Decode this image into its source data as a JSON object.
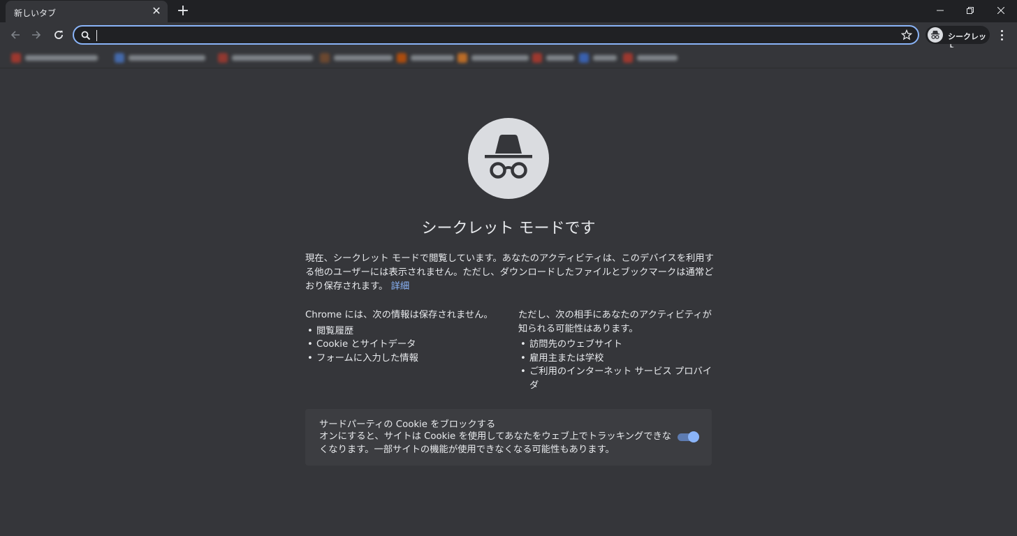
{
  "tab": {
    "title": "新しいタブ"
  },
  "toolbar": {
    "omnibox_value": "",
    "profile_label": "シークレット"
  },
  "main": {
    "heading": "シークレット モードです",
    "intro": "現在、シークレット モードで閲覧しています。あなたのアクティビティは、このデバイスを利用する他のユーザーには表示されません。ただし、ダウンロードしたファイルとブックマークは通常どおり保存されます。",
    "learn_more": "詳細",
    "not_saved": {
      "title": "Chrome には、次の情報は保存されません。",
      "items": [
        "閲覧履歴",
        "Cookie とサイトデータ",
        "フォームに入力した情報"
      ]
    },
    "may_be_visible": {
      "title": "ただし、次の相手にあなたのアクティビティが知られる可能性はあります。",
      "items": [
        "訪問先のウェブサイト",
        "雇用主または学校",
        "ご利用のインターネット サービス プロバイダ"
      ]
    },
    "cookie_block": {
      "title": "サードパーティの Cookie をブロックする",
      "description": "オンにすると、サイトは Cookie を使用してあなたをウェブ上でトラッキングできなくなります。一部サイトの機能が使用できなくなる可能性もあります。",
      "enabled": true
    }
  },
  "colors": {
    "background": "#35363a",
    "titlebar": "#202124",
    "accent": "#8ab4f8",
    "logo": "#dadce0"
  }
}
